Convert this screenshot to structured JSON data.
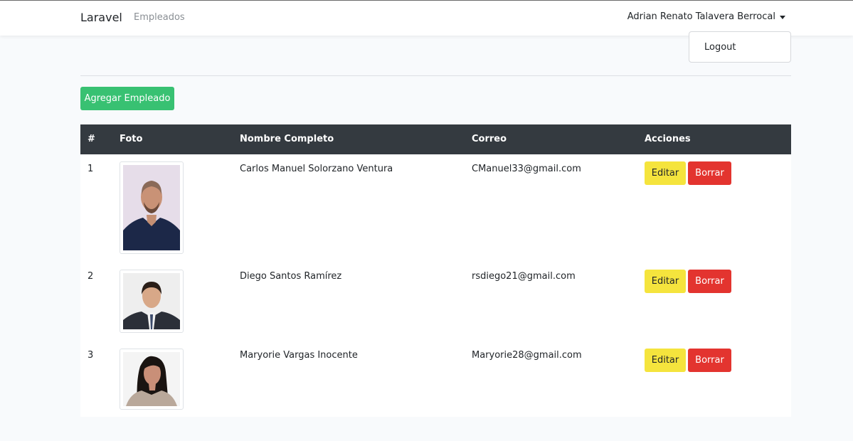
{
  "navbar": {
    "brand": "Laravel",
    "link": "Empleados",
    "user": "Adrian Renato Talavera Berrocal",
    "dropdown_item": "Logout"
  },
  "actions": {
    "add_label": "Agregar Empleado"
  },
  "table": {
    "headers": [
      "#",
      "Foto",
      "Nombre Completo",
      "Correo",
      "Acciones"
    ],
    "rows": [
      {
        "id": "1",
        "name": "Carlos Manuel Solorzano Ventura",
        "email": "CManuel33@gmail.com",
        "edit": "Editar",
        "delete": "Borrar"
      },
      {
        "id": "2",
        "name": "Diego Santos Ramírez",
        "email": "rsdiego21@gmail.com",
        "edit": "Editar",
        "delete": "Borrar"
      },
      {
        "id": "3",
        "name": "Maryorie Vargas Inocente",
        "email": "Maryorie28@gmail.com",
        "edit": "Editar",
        "delete": "Borrar"
      }
    ]
  },
  "colors": {
    "success": "#38c172",
    "warning": "#f5e43d",
    "danger": "#e3342f",
    "table_header": "#343a40"
  }
}
